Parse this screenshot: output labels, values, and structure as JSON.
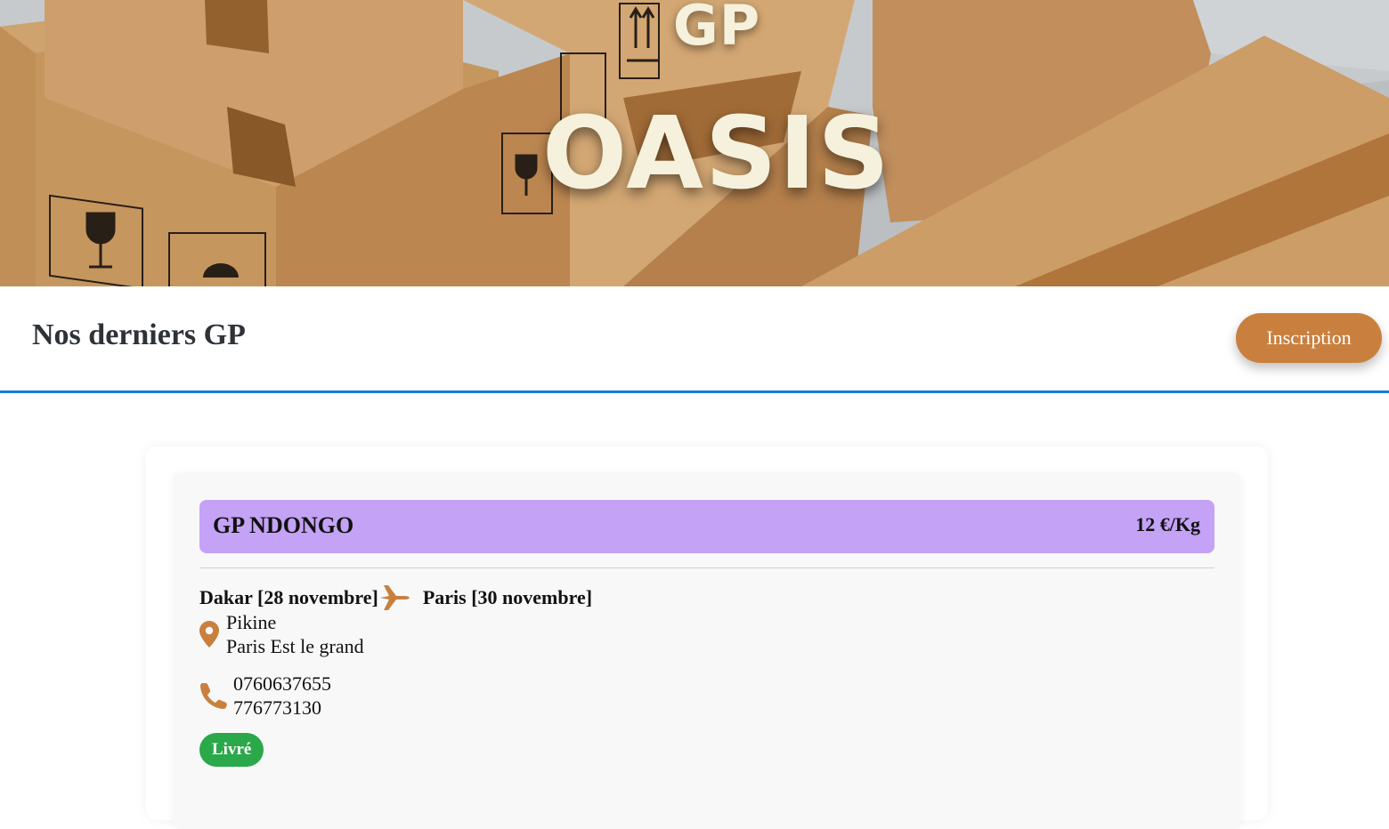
{
  "hero": {
    "title_small": "GP",
    "title_big": "OASIS"
  },
  "section": {
    "title": "Nos derniers GP",
    "signup_label": "Inscription"
  },
  "listings": [
    {
      "name": "GP NDONGO",
      "price": "12 €/Kg",
      "departure": "Dakar [28 novembre]",
      "arrival": "Paris [30 novembre]",
      "locations": [
        "Pikine",
        "Paris Est le grand"
      ],
      "phones": [
        "0760637655",
        "776773130"
      ],
      "status": "Livré"
    }
  ],
  "colors": {
    "accent": "#c9803f",
    "header_band": "#c4a2f5",
    "status_delivered": "#2aa84a",
    "divider_blue": "#1a7be0",
    "hero_text": "#f6f1dc"
  },
  "icons": {
    "route": "airplane-icon",
    "location": "map-pin-icon",
    "phone": "phone-icon"
  }
}
